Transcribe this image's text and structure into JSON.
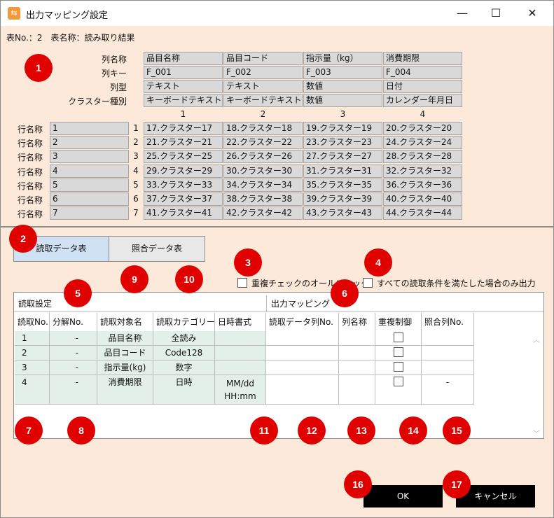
{
  "window": {
    "title": "出力マッピング設定",
    "app_icon": "mapping-app-icon",
    "minimize": "—",
    "maximize": "☐",
    "close": "✕"
  },
  "subtitle": "表No.：2　表名称：読み取り結果",
  "meta_labels": [
    "列名称",
    "列キー",
    "列型",
    "クラスター種別"
  ],
  "columns": [
    {
      "name": "品目名称",
      "key": "F_001",
      "type": "テキスト",
      "cluster": "キーボードテキスト",
      "num": "1"
    },
    {
      "name": "品目コード",
      "key": "F_002",
      "type": "テキスト",
      "cluster": "キーボードテキスト",
      "num": "2"
    },
    {
      "name": "指示量（kg）",
      "key": "F_003",
      "type": "数値",
      "cluster": "数値",
      "num": "3"
    },
    {
      "name": "消費期限",
      "key": "F_004",
      "type": "日付",
      "cluster": "カレンダー年月日",
      "num": "4"
    }
  ],
  "row_label": "行名称",
  "rows": [
    {
      "name": "1",
      "num": "1",
      "cells": [
        "17.クラスター17",
        "18.クラスター18",
        "19.クラスター19",
        "20.クラスター20"
      ]
    },
    {
      "name": "2",
      "num": "2",
      "cells": [
        "21.クラスター21",
        "22.クラスター22",
        "23.クラスター23",
        "24.クラスター24"
      ]
    },
    {
      "name": "3",
      "num": "3",
      "cells": [
        "25.クラスター25",
        "26.クラスター26",
        "27.クラスター27",
        "28.クラスター28"
      ]
    },
    {
      "name": "4",
      "num": "4",
      "cells": [
        "29.クラスター29",
        "30.クラスター30",
        "31.クラスター31",
        "32.クラスター32"
      ]
    },
    {
      "name": "5",
      "num": "5",
      "cells": [
        "33.クラスター33",
        "34.クラスター34",
        "35.クラスター35",
        "36.クラスター36"
      ]
    },
    {
      "name": "6",
      "num": "6",
      "cells": [
        "37.クラスター37",
        "38.クラスター38",
        "39.クラスター39",
        "40.クラスター40"
      ]
    },
    {
      "name": "7",
      "num": "7",
      "cells": [
        "41.クラスター41",
        "42.クラスター42",
        "43.クラスター43",
        "44.クラスター44"
      ]
    }
  ],
  "tabs": {
    "read": "読取データ表",
    "match": "照合データ表"
  },
  "checks": {
    "dup_all": "重複チェックのオールチェック",
    "all_conditions": "すべての読取条件を満たした場合のみ出力"
  },
  "sections": {
    "read": "読取設定",
    "output": "出力マッピング"
  },
  "headers": [
    "読取No.",
    "分解No.",
    "読取対象名",
    "読取カテゴリー",
    "日時書式",
    "読取データ列No.",
    "列名称",
    "重複制御",
    "照合列No."
  ],
  "table_rows": [
    {
      "no": "1",
      "split": "-",
      "target": "品目名称",
      "category": "全読み",
      "format": "",
      "match": ""
    },
    {
      "no": "2",
      "split": "-",
      "target": "品目コード",
      "category": "Code128",
      "format": "",
      "match": ""
    },
    {
      "no": "3",
      "split": "-",
      "target": "指示量(kg)",
      "category": "数字",
      "format": "",
      "match": ""
    },
    {
      "no": "4",
      "split": "-",
      "target": "消費期限",
      "category": "日時",
      "format": "MM/dd HH:mm",
      "format_line1": "MM/dd",
      "format_line2": "HH:mm",
      "match": "-"
    }
  ],
  "buttons": {
    "ok": "OK",
    "cancel": "キャンセル"
  },
  "badges": [
    "1",
    "2",
    "3",
    "4",
    "5",
    "6",
    "7",
    "8",
    "9",
    "10",
    "11",
    "12",
    "13",
    "14",
    "15",
    "16",
    "17"
  ],
  "colors": {
    "panel": "#fde9d9",
    "badge": "#e00000",
    "tab_active": "#cfe1f3",
    "cell": "#d9d9d9",
    "row_green": "#e3efe9"
  }
}
